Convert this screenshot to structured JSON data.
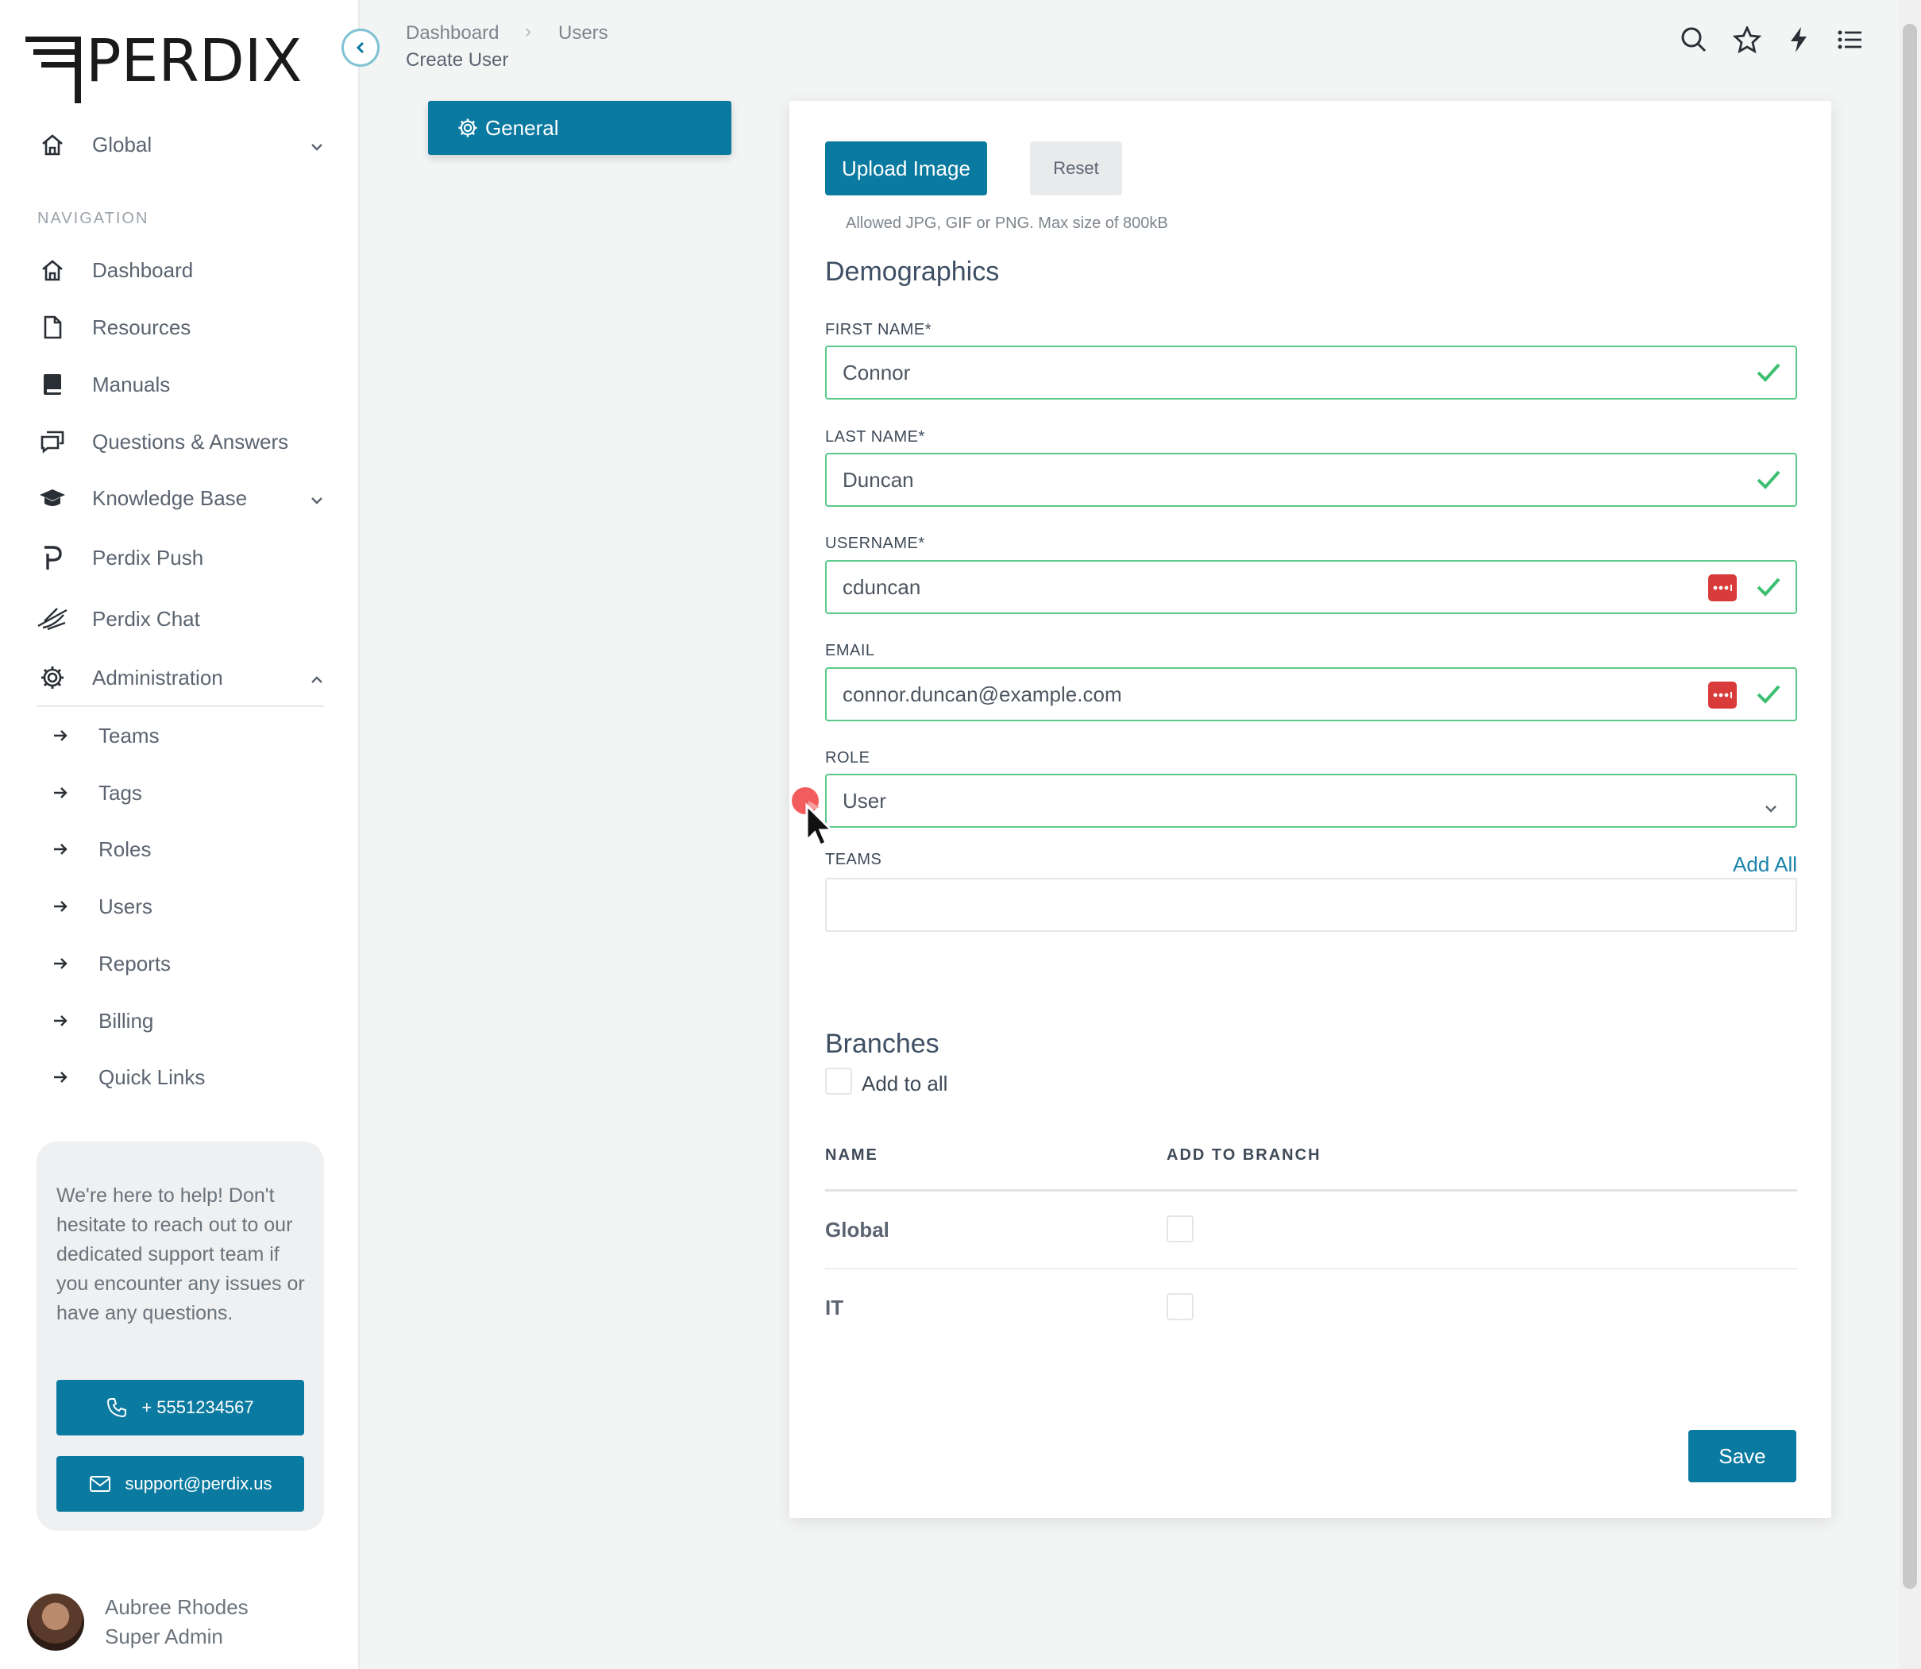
{
  "brand": {
    "logo_text": "PERDIX"
  },
  "sidebar": {
    "branch_selector": "Global",
    "section_label": "NAVIGATION",
    "items": [
      {
        "label": "Dashboard",
        "icon": "home-icon"
      },
      {
        "label": "Resources",
        "icon": "file-icon"
      },
      {
        "label": "Manuals",
        "icon": "book-icon"
      },
      {
        "label": "Questions & Answers",
        "icon": "chat-icon"
      },
      {
        "label": "Knowledge Base",
        "icon": "graduation-cap-icon"
      },
      {
        "label": "Perdix Push",
        "icon": "perdix-p-icon"
      },
      {
        "label": "Perdix Chat",
        "icon": "bird-icon"
      },
      {
        "label": "Administration",
        "icon": "gear-icon"
      }
    ],
    "admin_items": [
      "Teams",
      "Tags",
      "Roles",
      "Users",
      "Reports",
      "Billing",
      "Quick Links"
    ],
    "help": {
      "text": "We're here to help! Don't hesitate to reach out to our dedicated support team if you encounter any issues or have any questions.",
      "phone": "+ 5551234567",
      "email": "support@perdix.us"
    },
    "user": {
      "name": "Aubree Rhodes",
      "role": "Super Admin"
    }
  },
  "breadcrumb": {
    "items": [
      "Dashboard",
      "Users"
    ],
    "current": "Create User"
  },
  "tab": {
    "general": "General"
  },
  "form": {
    "upload_label": "Upload Image",
    "reset_label": "Reset",
    "upload_hint": "Allowed JPG, GIF or PNG. Max size of 800kB",
    "demographics_title": "Demographics",
    "first_name": {
      "label": "FIRST NAME*",
      "value": "Connor"
    },
    "last_name": {
      "label": "LAST NAME*",
      "value": "Duncan"
    },
    "username": {
      "label": "USERNAME*",
      "value": "cduncan"
    },
    "email": {
      "label": "EMAIL",
      "value": "connor.duncan@example.com"
    },
    "role": {
      "label": "ROLE",
      "value": "User"
    },
    "teams": {
      "label": "TEAMS",
      "add_all": "Add All",
      "value": ""
    },
    "branches_title": "Branches",
    "add_to_all": "Add to all",
    "table": {
      "headers": [
        "NAME",
        "ADD TO BRANCH"
      ],
      "rows": [
        {
          "name": "Global"
        },
        {
          "name": "IT"
        }
      ]
    },
    "save_label": "Save"
  },
  "colors": {
    "accent": "#0b7aa0",
    "valid": "#5cc98a",
    "error": "#d93a3a"
  }
}
